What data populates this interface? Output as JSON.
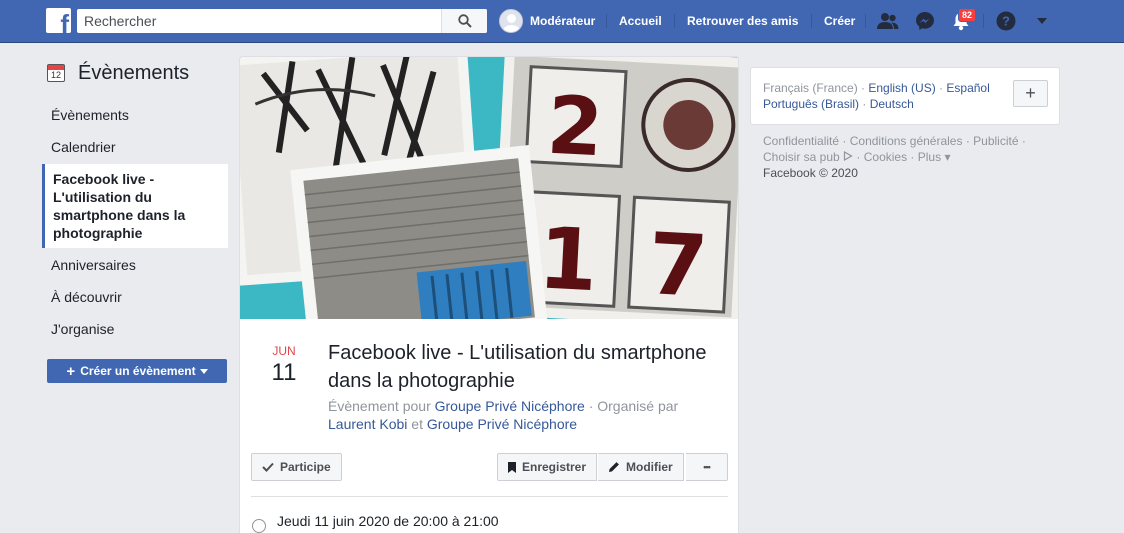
{
  "topbar": {
    "logo": "f",
    "search_placeholder": "Rechercher",
    "user_name": "Modérateur",
    "home": "Accueil",
    "find_friends": "Retrouver des amis",
    "create": "Créer",
    "notifications_count": "82",
    "help": "?",
    "icons": [
      "friends-icon",
      "messenger-icon",
      "bell-icon",
      "help-icon",
      "caret-down-icon"
    ]
  },
  "sidebar": {
    "title": "Évènements",
    "calendar_day": "12",
    "items": [
      {
        "label": "Évènements"
      },
      {
        "label": "Calendrier"
      },
      {
        "label": "Facebook live - L'utilisation du smartphone dans la photographie"
      },
      {
        "label": "Anniversaires"
      },
      {
        "label": "À découvrir"
      },
      {
        "label": "J'organise"
      }
    ],
    "create_button": "Créer un évènement"
  },
  "event": {
    "month": "JUN",
    "day": "11",
    "title": "Facebook live - L'utilisation du smartphone dans la photographie",
    "meta_prefix": "Évènement pour",
    "group": "Groupe Privé Nicéphore",
    "organised_by": "· Organisé par",
    "organiser": "Laurent Kobi",
    "and": "et",
    "group2": "Groupe Privé Nicéphore",
    "going_button": "Participe",
    "save_button": "Enregistrer",
    "edit_button": "Modifier",
    "more_button": "•••",
    "when": "Jeudi 11 juin 2020 de 20:00 à 21:00",
    "cover_numbers": [
      "2",
      "1",
      "7"
    ],
    "cover_colors": {
      "sky": "#35bcc8",
      "brick": "#8a8a86",
      "blue_door": "#2f7ebf"
    }
  },
  "right": {
    "languages": [
      {
        "label": "Français (France)",
        "active": true
      },
      {
        "label": "English (US)"
      },
      {
        "label": "Español"
      },
      {
        "label": "Português (Brasil)"
      },
      {
        "label": "Deutsch"
      }
    ],
    "add_language": "+",
    "footer_links": [
      "Confidentialité",
      "Conditions générales",
      "Publicité",
      "Choisir sa pub",
      "Cookies",
      "Plus"
    ],
    "copyright": "Facebook © 2020"
  }
}
